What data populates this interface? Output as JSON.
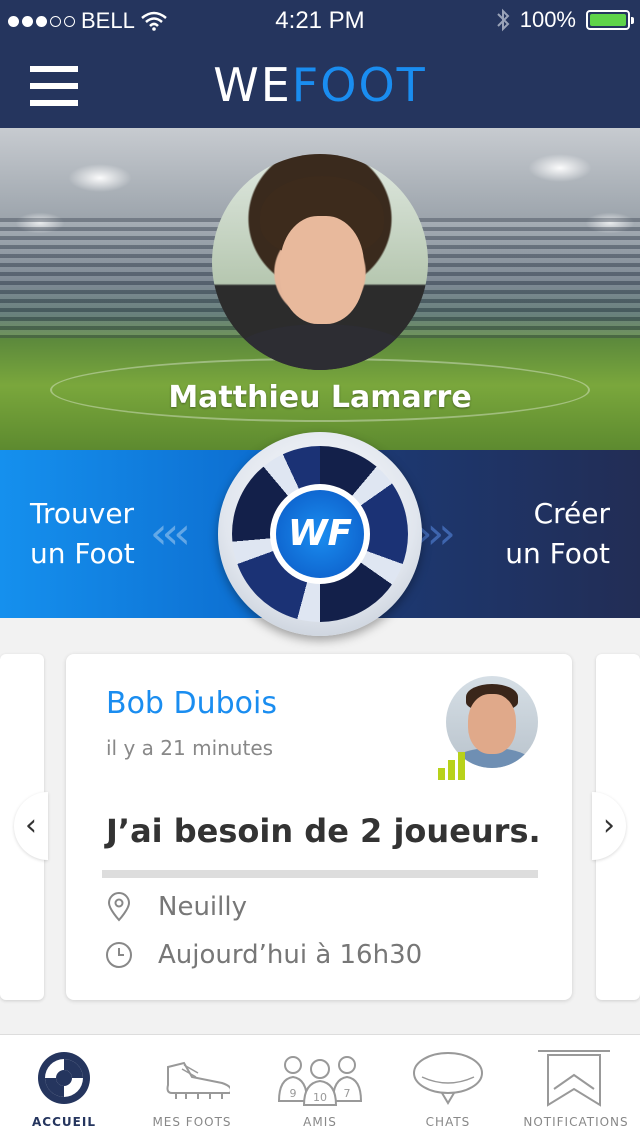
{
  "status_bar": {
    "carrier": "BELL",
    "time": "4:21 PM",
    "battery": "100%",
    "battery_level": 1.0,
    "signal_bars_filled": 3,
    "signal_bars_total": 5
  },
  "nav": {
    "logo_we": "WE",
    "logo_foot": "FOOT",
    "menu_icon": "hamburger-menu-icon"
  },
  "profile": {
    "name": "Matthieu Lamarre"
  },
  "actions": {
    "find_line1": "Trouver",
    "find_line2": "un Foot",
    "create_line1": "Créer",
    "create_line2": "un Foot",
    "badge": "WF",
    "left_chevrons": "‹‹‹",
    "right_chevrons": "›››"
  },
  "feed_card": {
    "author": "Bob Dubois",
    "time_ago": "il y a 21 minutes",
    "message": "J’ai besoin de 2 joueurs.",
    "location": "Neuilly",
    "datetime": "Aujourd’hui à 16h30",
    "signal_level": 3,
    "colors": {
      "author": "#1a8df0",
      "signal": "#b8d21a"
    }
  },
  "carousel": {
    "prev_arrow": "‹",
    "next_arrow": "›"
  },
  "tabs": [
    {
      "label": "ACCUEIL",
      "icon": "home-lens-icon",
      "active": true
    },
    {
      "label": "MES FOOTS",
      "icon": "football-boot-icon",
      "active": false
    },
    {
      "label": "AMIS",
      "icon": "friends-icon",
      "active": false,
      "jersey_numbers": [
        "9",
        "10",
        "7"
      ]
    },
    {
      "label": "CHATS",
      "icon": "chat-bubble-icon",
      "active": false
    },
    {
      "label": "NOTIFICATIONS",
      "icon": "notification-flag-icon",
      "active": false
    }
  ],
  "colors": {
    "nav_bg": "#25355e",
    "accent": "#1a8df0",
    "cta_left": "#1590ee",
    "cta_right": "#222d55"
  }
}
